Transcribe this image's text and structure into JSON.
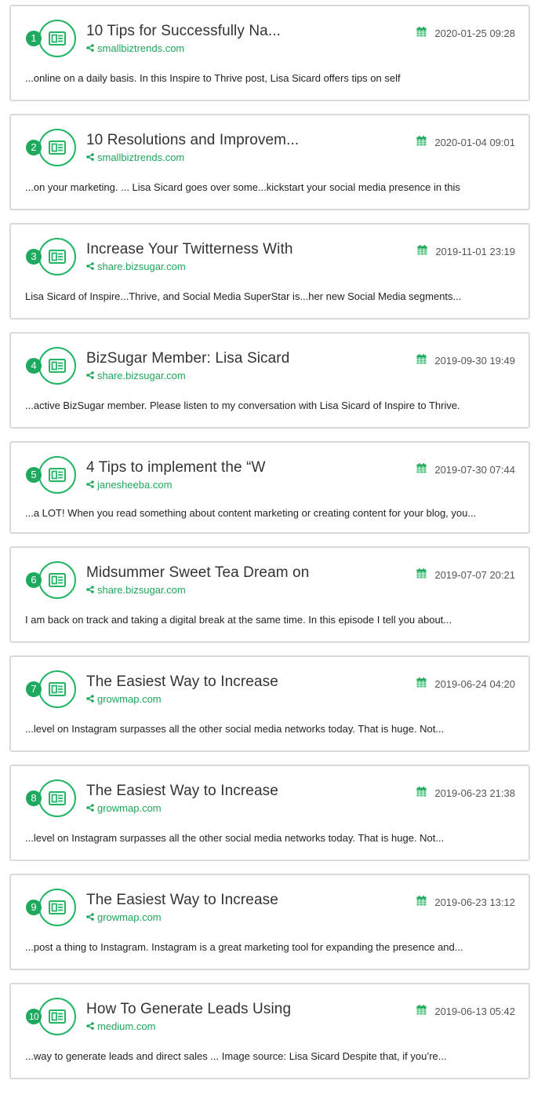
{
  "results": [
    {
      "rank": "1",
      "title": "10 Tips for Successfully Na...",
      "source": "smallbiztrends.com",
      "date": "2020-01-25 09:28",
      "snippet": "...online on a daily basis. In this Inspire to Thrive post, Lisa Sicard offers tips on self"
    },
    {
      "rank": "2",
      "title": "10 Resolutions and Improvem...",
      "source": "smallbiztrends.com",
      "date": "2020-01-04 09:01",
      "snippet": "...on your marketing. ... Lisa Sicard goes over some...kickstart your social media presence in this"
    },
    {
      "rank": "3",
      "title": "Increase Your Twitterness With",
      "source": "share.bizsugar.com",
      "date": "2019-11-01 23:19",
      "snippet": "Lisa Sicard of Inspire...Thrive, and Social Media SuperStar is...her new Social Media segments..."
    },
    {
      "rank": "4",
      "title": "BizSugar Member: Lisa Sicard",
      "source": "share.bizsugar.com",
      "date": "2019-09-30 19:49",
      "snippet": "...active BizSugar member. Please listen to my conversation with Lisa Sicard of Inspire to Thrive."
    },
    {
      "rank": "5",
      "title": "4 Tips to implement the “W",
      "source": "janesheeba.com",
      "date": "2019-07-30 07:44",
      "snippet": "...a LOT! When you read something about content marketing or creating content for your blog, you..."
    },
    {
      "rank": "6",
      "title": "Midsummer Sweet Tea Dream on",
      "source": "share.bizsugar.com",
      "date": "2019-07-07 20:21",
      "snippet": "I am back on track and taking a digital break at the same time. In this episode I tell you about..."
    },
    {
      "rank": "7",
      "title": "The Easiest Way to Increase",
      "source": "growmap.com",
      "date": "2019-06-24 04:20",
      "snippet": "...level on Instagram surpasses all the other social media networks today. That is huge. Not..."
    },
    {
      "rank": "8",
      "title": "The Easiest Way to Increase",
      "source": "growmap.com",
      "date": "2019-06-23 21:38",
      "snippet": "...level on Instagram surpasses all the other social media networks today. That is huge. Not..."
    },
    {
      "rank": "9",
      "title": "The Easiest Way to Increase",
      "source": "growmap.com",
      "date": "2019-06-23 13:12",
      "snippet": "...post a thing to Instagram. Instagram is a great marketing tool for expanding the presence and..."
    },
    {
      "rank": "10",
      "title": "How To Generate Leads Using",
      "source": "medium.com",
      "date": "2019-06-13 05:42",
      "snippet": "...way to generate leads and direct sales ... Image source: Lisa Sicard Despite that, if you’re..."
    }
  ],
  "icons": {
    "article": "newspaper-icon",
    "source": "share-icon",
    "date": "calendar-icon"
  },
  "colors": {
    "accent": "#1eaa5e",
    "text": "#222222",
    "border": "#d9d9de"
  }
}
